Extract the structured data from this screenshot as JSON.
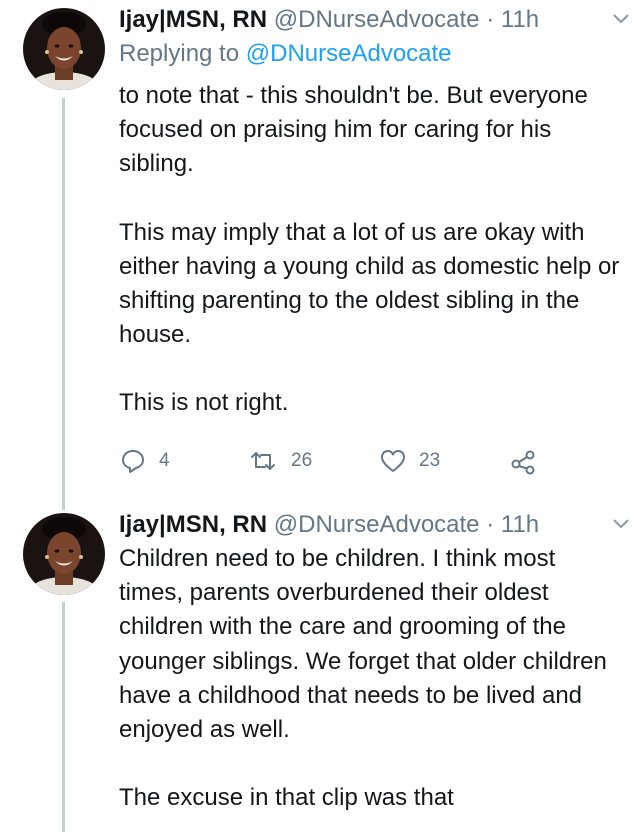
{
  "tweets": [
    {
      "display_name": "Ijay|MSN, RN",
      "handle": "@DNurseAdvocate",
      "separator": "·",
      "time": "11h",
      "replying_label": "Replying to",
      "replying_mention": "@DNurseAdvocate",
      "paragraphs": [
        "to note that - this shouldn't be. But everyone focused on praising him for caring for his sibling.",
        "This may imply that a lot of us are okay with either having a young child as domestic help or shifting parenting to the oldest sibling in the house.",
        "This is not right."
      ],
      "actions": {
        "replies": "4",
        "retweets": "26",
        "likes": "23"
      },
      "icons": [
        "reply-icon",
        "retweet-icon",
        "like-icon",
        "share-icon",
        "chevron-down-icon"
      ]
    },
    {
      "display_name": "Ijay|MSN, RN",
      "handle": "@DNurseAdvocate",
      "separator": "·",
      "time": "11h",
      "paragraphs": [
        "Children need to be children. I think most times, parents overburdened their oldest children with the care and grooming of the younger siblings. We forget that older children have a childhood that needs to be lived and enjoyed as well.",
        "The excuse in that clip was that"
      ],
      "icons": [
        "chevron-down-icon"
      ]
    }
  ],
  "colors": {
    "text": "#14171a",
    "muted": "#657786",
    "link": "#1da1f2",
    "thread_line": "#c4cfd6"
  }
}
